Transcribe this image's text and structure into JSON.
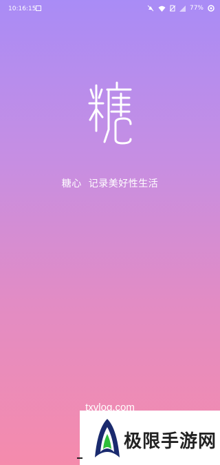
{
  "status_bar": {
    "time": "10:16:15",
    "battery": "77%",
    "icons": [
      "image-icon",
      "mute-icon",
      "wifi-icon",
      "no-sim-icon",
      "signal-icon",
      "rotate-icon"
    ]
  },
  "splash": {
    "logo_char": "糖",
    "app_name": "糖心",
    "slogan": "记录美好性生活",
    "website": "txvlog.com"
  },
  "watermark": {
    "text": "极限手游网"
  },
  "colors": {
    "gradient_top": "#a98cf6",
    "gradient_mid": "#c78ee2",
    "gradient_bottom": "#f58bac",
    "text": "#ffffff"
  }
}
